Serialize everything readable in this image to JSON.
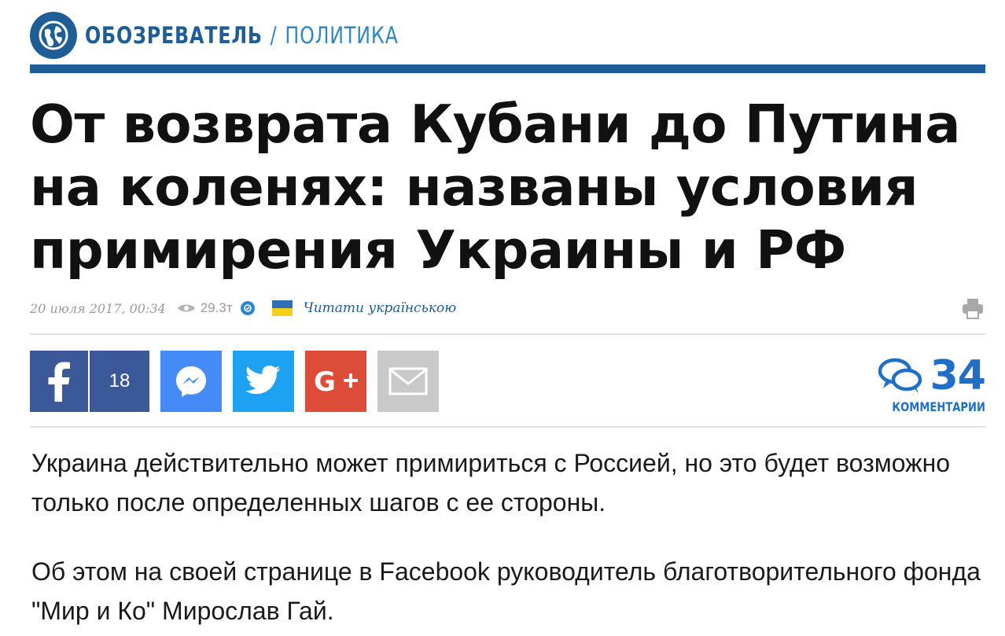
{
  "header": {
    "brand": "ОБОЗРЕВАТЕЛЬ",
    "separator": "/",
    "section": "ПОЛИТИКА",
    "logo_icon": "globe-icon",
    "brand_color": "#1f5d96",
    "accent_color": "#2f86c8"
  },
  "article": {
    "headline_lines": [
      "От возврата Кубани до Путина",
      "на коленях: названы условия",
      "примирения Украины и РФ"
    ],
    "meta": {
      "date": "20 июля 2017, 00:34",
      "views": "29.3т",
      "read_ukrainian": "Читати українською",
      "icons": [
        "eye-icon",
        "verified-icon",
        "ukraine-flag-icon",
        "print-icon"
      ]
    },
    "share": {
      "facebook_count": "18",
      "buttons": [
        "facebook",
        "messenger",
        "twitter",
        "google-plus",
        "email"
      ],
      "colors": {
        "facebook": "#3b5998",
        "messenger": "#448bf7",
        "twitter": "#1da1f2",
        "google_plus": "#dd4b39",
        "email": "#c9c9c9"
      }
    },
    "comments": {
      "count": "34",
      "label": "КОММЕНТАРИИ",
      "color": "#1f6fc6"
    },
    "paragraphs": [
      "Украина действительно может примириться с Россией, но это будет возможно только после определенных шагов с ее стороны.",
      "Об этом на своей странице в Facebook руководитель благотворительного фонда \"Мир и Ко\" Мирослав Гай."
    ]
  }
}
